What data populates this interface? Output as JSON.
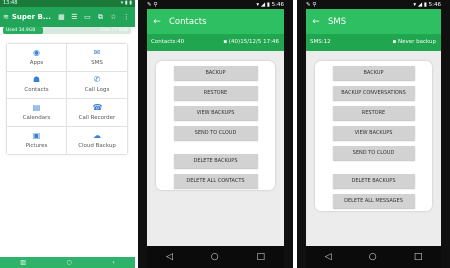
{
  "screen1": {
    "status": {
      "time": "13:48",
      "right": "▾ ▮ ▮"
    },
    "title": "Super B...",
    "storage": {
      "used": "Used 34.9GB",
      "free": "Free 77.6GB",
      "used_fraction": 0.31
    },
    "grid": [
      {
        "label": "Apps",
        "icon": "android-icon"
      },
      {
        "label": "SMS",
        "icon": "sms-icon"
      },
      {
        "label": "Contacts",
        "icon": "contacts-icon"
      },
      {
        "label": "Call Logs",
        "icon": "call-logs-icon"
      },
      {
        "label": "Calendars",
        "icon": "calendar-icon"
      },
      {
        "label": "Call Recorder",
        "icon": "call-recorder-icon"
      },
      {
        "label": "Pictures",
        "icon": "pictures-icon"
      },
      {
        "label": "Cloud Backup",
        "icon": "cloud-backup-icon"
      }
    ]
  },
  "screen2": {
    "status": {
      "time": "5:46"
    },
    "title": "Contacts",
    "info": {
      "left": "Contacts:40",
      "right": "(40)15/12/5 17:46"
    },
    "buttons": [
      "BACKUP",
      "RESTORE",
      "VIEW BACKUPS",
      "SEND TO CLOUD",
      "DELETE BACKUPS",
      "DELETE ALL CONTACTS"
    ]
  },
  "screen3": {
    "status": {
      "time": "5:46"
    },
    "title": "SMS",
    "info": {
      "left": "SMS:12",
      "right": "Never backup"
    },
    "buttons": [
      "BACKUP",
      "BACKUP CONVERSATIONS",
      "RESTORE",
      "VIEW BACKUPS",
      "SEND TO CLOUD",
      "DELETE BACKUPS",
      "DELETE ALL MESSAGES"
    ]
  },
  "colors": {
    "accent": "#2fbf63",
    "dark_accent": "#1fa64f",
    "icon_blue": "#3b7fd4"
  }
}
